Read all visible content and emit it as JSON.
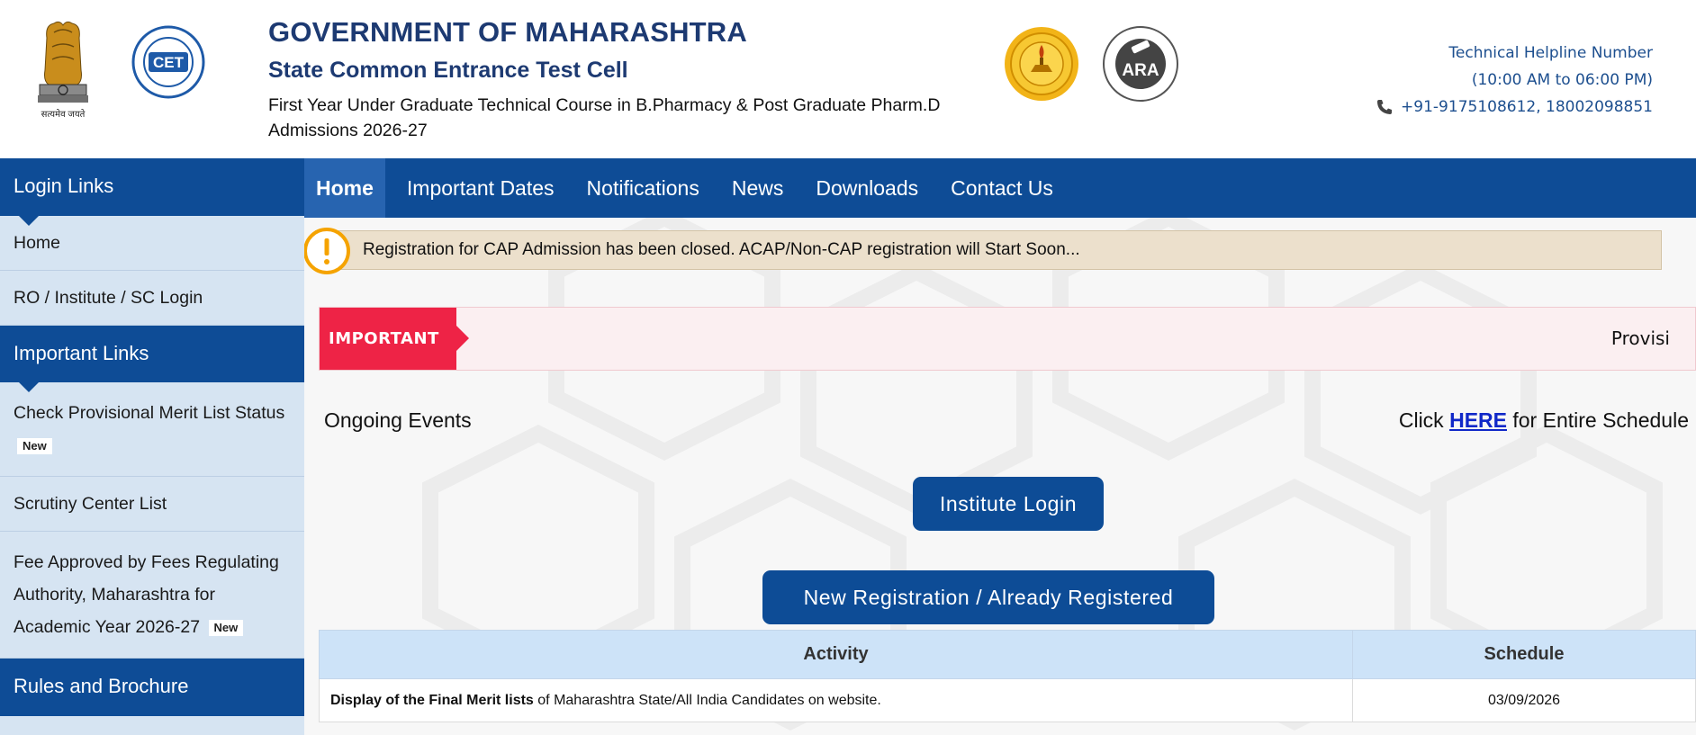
{
  "header": {
    "title": "GOVERNMENT OF MAHARASHTRA",
    "subtitle": "State Common Entrance Test Cell",
    "course_line1": "First Year Under Graduate Technical Course in B.Pharmacy & Post Graduate Pharm.D",
    "course_line2": "Admissions 2026-27",
    "emblem_text": "सत्यमेव जयते",
    "cet_logo_text": "CET",
    "ara_logo_text": "ARA",
    "helpline_title": "Technical Helpline Number",
    "helpline_hours": "(10:00 AM to 06:00 PM)",
    "helpline_numbers": "+91-9175108612, 18002098851"
  },
  "sidebar": {
    "login_heading": "Login Links",
    "login_items": [
      {
        "label": "Home"
      },
      {
        "label": "RO / Institute / SC Login"
      }
    ],
    "important_heading": "Important Links",
    "important_items": [
      {
        "label": "Check Provisional Merit List Status",
        "badge": "New"
      },
      {
        "label": "Scrutiny Center List"
      },
      {
        "label": "Fee Approved by Fees Regulating Authority, Maharashtra for Academic Year 2026-27",
        "badge": "New"
      }
    ],
    "rules_heading": "Rules and Brochure"
  },
  "nav": {
    "items": [
      {
        "label": "Home",
        "active": true
      },
      {
        "label": "Important Dates"
      },
      {
        "label": "Notifications"
      },
      {
        "label": "News"
      },
      {
        "label": "Downloads"
      },
      {
        "label": "Contact Us"
      }
    ]
  },
  "main": {
    "alert_text": "Registration for CAP Admission has been closed. ACAP/Non-CAP registration will Start Soon...",
    "ticker_label": "IMPORTANT",
    "ticker_text": "Provisi",
    "events_label": "Ongoing Events",
    "schedule_prefix": "Click ",
    "schedule_link": "HERE",
    "schedule_suffix": " for Entire Schedule",
    "institute_login_button": "Institute Login",
    "registration_button": "New Registration / Already Registered",
    "table": {
      "headers": [
        "Activity",
        "Schedule"
      ],
      "rows": [
        {
          "activity_bold": "Display of the Final Merit lists",
          "activity_rest": " of Maharashtra State/All India Candidates on website.",
          "schedule": "03/09/2026"
        }
      ]
    }
  },
  "colors": {
    "primary_blue": "#0e4c96",
    "nav_active": "#2764b0",
    "sidebar_bg": "#d6e4f2",
    "alert_bg": "#ece0cc",
    "alert_icon": "#f5a300",
    "ticker_red": "#ee2346",
    "link_blue": "#1028c8"
  }
}
